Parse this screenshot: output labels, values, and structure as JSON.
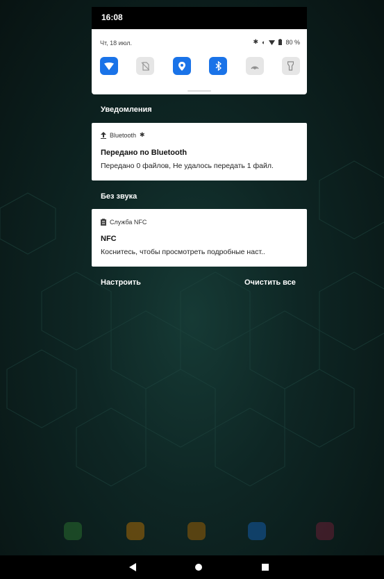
{
  "status_bar": {
    "time": "16:08"
  },
  "quick_settings": {
    "date": "Чт, 18 июл.",
    "battery": "80 %",
    "tiles": [
      {
        "name": "wifi-icon",
        "active": true
      },
      {
        "name": "no-sim-icon",
        "active": false
      },
      {
        "name": "location-icon",
        "active": true
      },
      {
        "name": "bluetooth-icon",
        "active": true
      },
      {
        "name": "nfc-icon",
        "active": false
      },
      {
        "name": "flashlight-icon",
        "active": false
      }
    ]
  },
  "sections": {
    "notifications": "Уведомления",
    "silent": "Без звука"
  },
  "notifications": [
    {
      "app": "Bluetooth",
      "title": "Передано по Bluetooth",
      "text": "Передано 0 файлов, Не удалось передать 1 файл."
    },
    {
      "app": "Служба NFC",
      "title": "NFC",
      "text": "Коснитесь, чтобы просмотреть подробные наст.."
    }
  ],
  "actions": {
    "manage": "Настроить",
    "clear_all": "Очистить все"
  },
  "colors": {
    "accent": "#1a73e8",
    "tile_off": "#e6e6e6",
    "wallpaper": "#0e2624"
  }
}
